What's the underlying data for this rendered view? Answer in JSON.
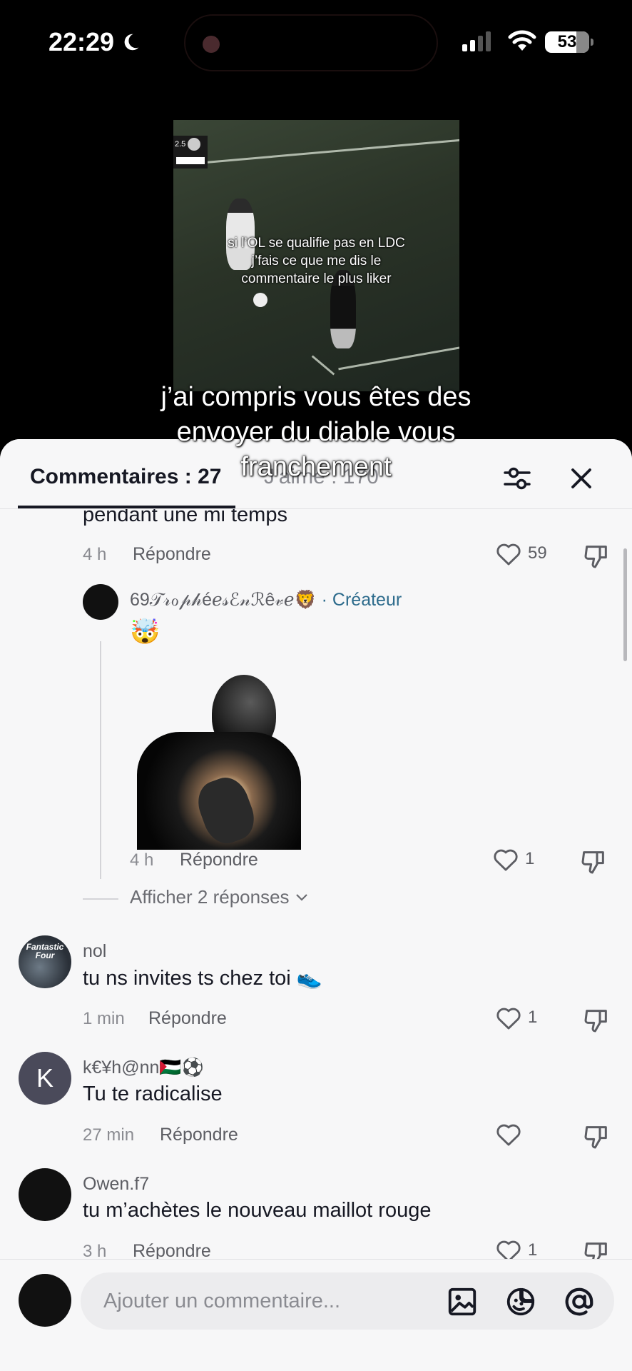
{
  "status_bar": {
    "time": "22:29",
    "battery": "53"
  },
  "video": {
    "scorebug_text": "2.5",
    "caption_lines": [
      "si l’OL se qualifie pas en LDC",
      "j’fais ce que me dis le",
      "commentaire le plus liker"
    ]
  },
  "overlay": {
    "lines": [
      "j’ai compris vous êtes des",
      "envoyer du diable vous",
      "franchement"
    ]
  },
  "sheet": {
    "tab_comments": "Commentaires : 27",
    "tab_likes": "J'aime : 170"
  },
  "comments": [
    {
      "partial_text": "pendant une mi temps",
      "time": "4 h",
      "reply_label": "Répondre",
      "likes": "59"
    },
    {
      "username": "69𝒯𝓇ℴ𝓅𝒽éℯ𝓈ℰ𝓃ℛê𝓋ℯ🦁",
      "creator_label": "· Créateur",
      "emoji": "🤯",
      "time": "4 h",
      "reply_label": "Répondre",
      "likes": "1",
      "show_replies": "Afficher 2 réponses"
    },
    {
      "username": "nol",
      "text": "tu ns invites ts chez toi 👟",
      "time": "1 min",
      "reply_label": "Répondre",
      "likes": "1",
      "avatar_text": "Fantastic Four"
    },
    {
      "username": "k€¥h@nn🇵🇸⚽",
      "avatar_letter": "K",
      "text": "Tu te radicalise",
      "time": "27 min",
      "reply_label": "Répondre",
      "likes": ""
    },
    {
      "username": "Owen.f7",
      "text": "tu m’achètes le nouveau maillot rouge",
      "time": "3 h",
      "reply_label": "Répondre",
      "likes": "1"
    }
  ],
  "composer": {
    "placeholder": "Ajouter un commentaire..."
  },
  "colors": {
    "accent_creator": "#2d6b8c",
    "avatar_k": "#4a4a5a"
  }
}
